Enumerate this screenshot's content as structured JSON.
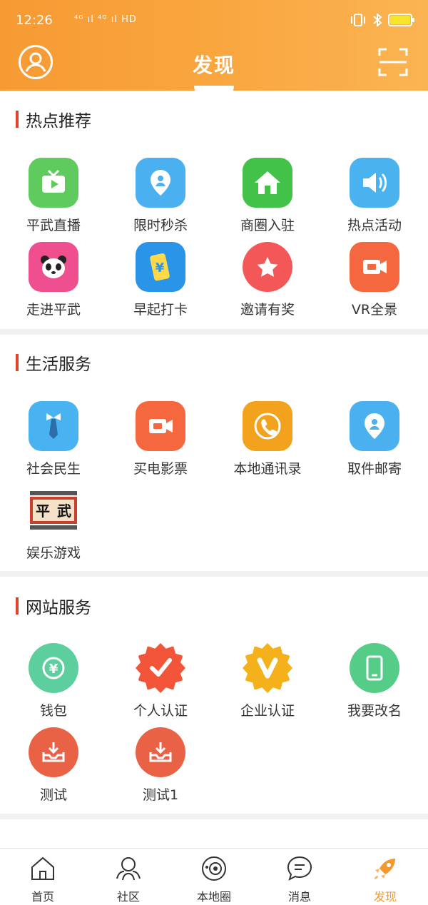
{
  "status": {
    "time": "12:26",
    "network": "⁴ᴳ ıl ⁴ᴳ ıl HD"
  },
  "header": {
    "title": "发现"
  },
  "sections": [
    {
      "title": "热点推荐",
      "items": [
        {
          "label": "平武直播",
          "icon": "tv-icon",
          "color": "#5fcb5f"
        },
        {
          "label": "限时秒杀",
          "icon": "location-pin-icon",
          "color": "#4bb0f0"
        },
        {
          "label": "商圈入驻",
          "icon": "house-icon",
          "color": "#43c24a"
        },
        {
          "label": "热点活动",
          "icon": "speaker-icon",
          "color": "#4ab3ef"
        },
        {
          "label": "走进平武",
          "icon": "panda-icon",
          "color": "#ef4f8f"
        },
        {
          "label": "早起打卡",
          "icon": "phone-yuan-icon",
          "color": "#2a95e8"
        },
        {
          "label": "邀请有奖",
          "icon": "star-icon",
          "color": "#f45757"
        },
        {
          "label": "VR全景",
          "icon": "video-camera-icon",
          "color": "#f5683f"
        }
      ]
    },
    {
      "title": "生活服务",
      "items": [
        {
          "label": "社会民生",
          "icon": "tie-icon",
          "color": "#48b3f0"
        },
        {
          "label": "买电影票",
          "icon": "video-camera-icon",
          "color": "#f5683f"
        },
        {
          "label": "本地通讯录",
          "icon": "phone-call-icon",
          "color": "#f3a21d"
        },
        {
          "label": "取件邮寄",
          "icon": "location-pin-icon",
          "color": "#4bb0f0"
        },
        {
          "label": "娱乐游戏",
          "icon": "game-logo-icon",
          "color": "#c9402f",
          "logo_text": "平武"
        }
      ]
    },
    {
      "title": "网站服务",
      "items": [
        {
          "label": "钱包",
          "icon": "wallet-yuan-icon",
          "color": "#5dcf9f"
        },
        {
          "label": "个人认证",
          "icon": "check-badge-icon",
          "color": "#f2553a"
        },
        {
          "label": "企业认证",
          "icon": "v-badge-icon",
          "color": "#f5b11b"
        },
        {
          "label": "我要改名",
          "icon": "mobile-icon",
          "color": "#55cc88"
        },
        {
          "label": "测试",
          "icon": "download-tray-icon",
          "color": "#ea6245"
        },
        {
          "label": "测试1",
          "icon": "download-tray-icon",
          "color": "#ea6245"
        }
      ]
    }
  ],
  "nav": {
    "tabs": [
      {
        "label": "首页",
        "icon": "home-icon"
      },
      {
        "label": "社区",
        "icon": "community-icon"
      },
      {
        "label": "本地圈",
        "icon": "local-circle-icon"
      },
      {
        "label": "消息",
        "icon": "message-icon"
      },
      {
        "label": "发现",
        "icon": "rocket-icon",
        "active": true
      }
    ],
    "active_color": "#f39a2e"
  },
  "colors": {
    "header_start": "#f79a33",
    "header_end": "#fbb452",
    "section_accent": "#e0432b"
  }
}
